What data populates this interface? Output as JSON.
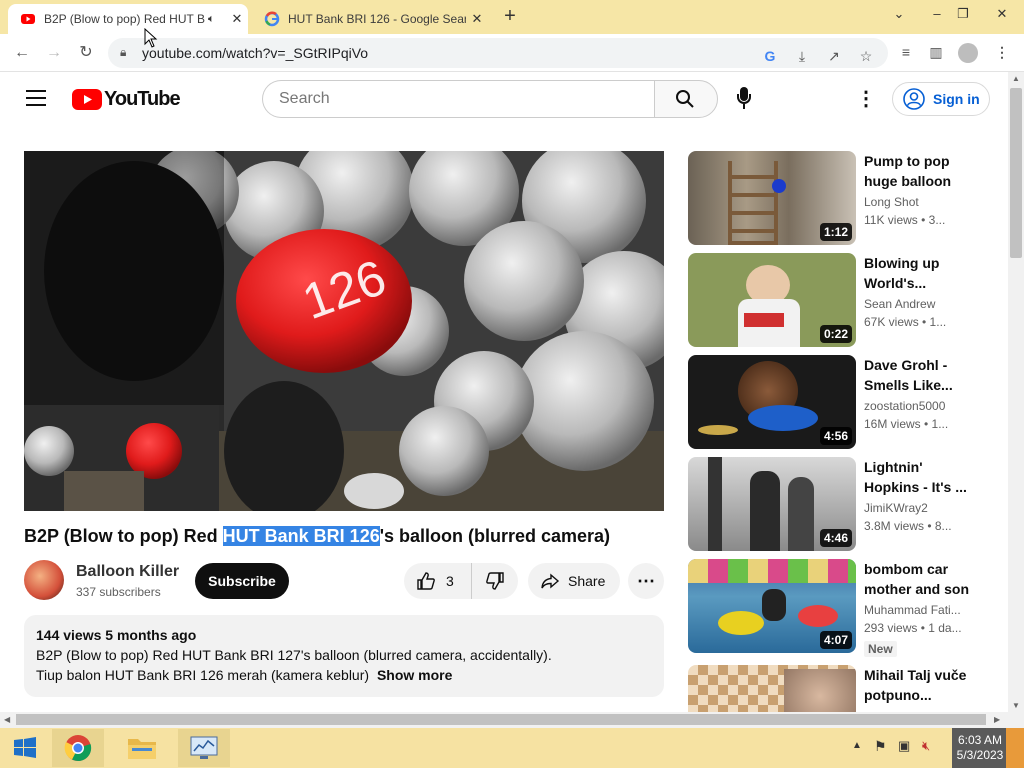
{
  "browser": {
    "tabs": [
      {
        "title": "B2P (Blow to pop) Red HUT B",
        "active": true
      },
      {
        "title": "HUT Bank BRI 126 - Google Sear",
        "active": false
      }
    ],
    "url": "youtube.com/watch?v=_SGtRIPqiVo"
  },
  "youtube": {
    "logo_text": "YouTube",
    "search_placeholder": "Search",
    "sign_in": "Sign in"
  },
  "video": {
    "title_before": "B2P (Blow to pop) Red ",
    "title_highlight": "HUT Bank BRI 126",
    "title_after": "'s balloon (blurred camera)",
    "channel": "Balloon Killer",
    "subscribers": "337 subscribers",
    "subscribe_label": "Subscribe",
    "likes": "3",
    "share_label": "Share",
    "description": {
      "meta": "144 views  5 months ago",
      "line1": "B2P (Blow to pop) Red HUT Bank BRI 127's balloon (blurred camera, accidentally).",
      "line2": "Tiup balon HUT Bank BRI 126 merah (kamera keblur)",
      "show_more": "Show more"
    }
  },
  "recommendations": [
    {
      "title": "Pump to pop huge balloon",
      "channel": "Long Shot",
      "views": "11K views  • 3...",
      "duration": "1:12"
    },
    {
      "title": "Blowing up World's...",
      "channel": "Sean Andrew",
      "views": "67K views  • 1...",
      "duration": "0:22"
    },
    {
      "title": "Dave Grohl - Smells Like...",
      "channel": "zoostation5000",
      "views": "16M views  • 1...",
      "duration": "4:56"
    },
    {
      "title": "Lightnin' Hopkins - It's ...",
      "channel": "JimiKWray2",
      "views": "3.8M views  • 8...",
      "duration": "4:46"
    },
    {
      "title": "bombom car mother and son",
      "channel": "Muhammad Fati...",
      "views": "293 views  • 1 da...",
      "duration": "4:07",
      "badge": "New"
    },
    {
      "title": "Mihail Talj vuče potpuno...",
      "channel": "",
      "views": "",
      "duration": ""
    }
  ],
  "taskbar": {
    "time": "6:03 AM",
    "date": "5/3/2023"
  },
  "colors": {
    "brand_red": "#ff0000",
    "link_blue": "#065fd4",
    "highlight": "#3584e4",
    "tab_strip": "#f6e6a6"
  }
}
